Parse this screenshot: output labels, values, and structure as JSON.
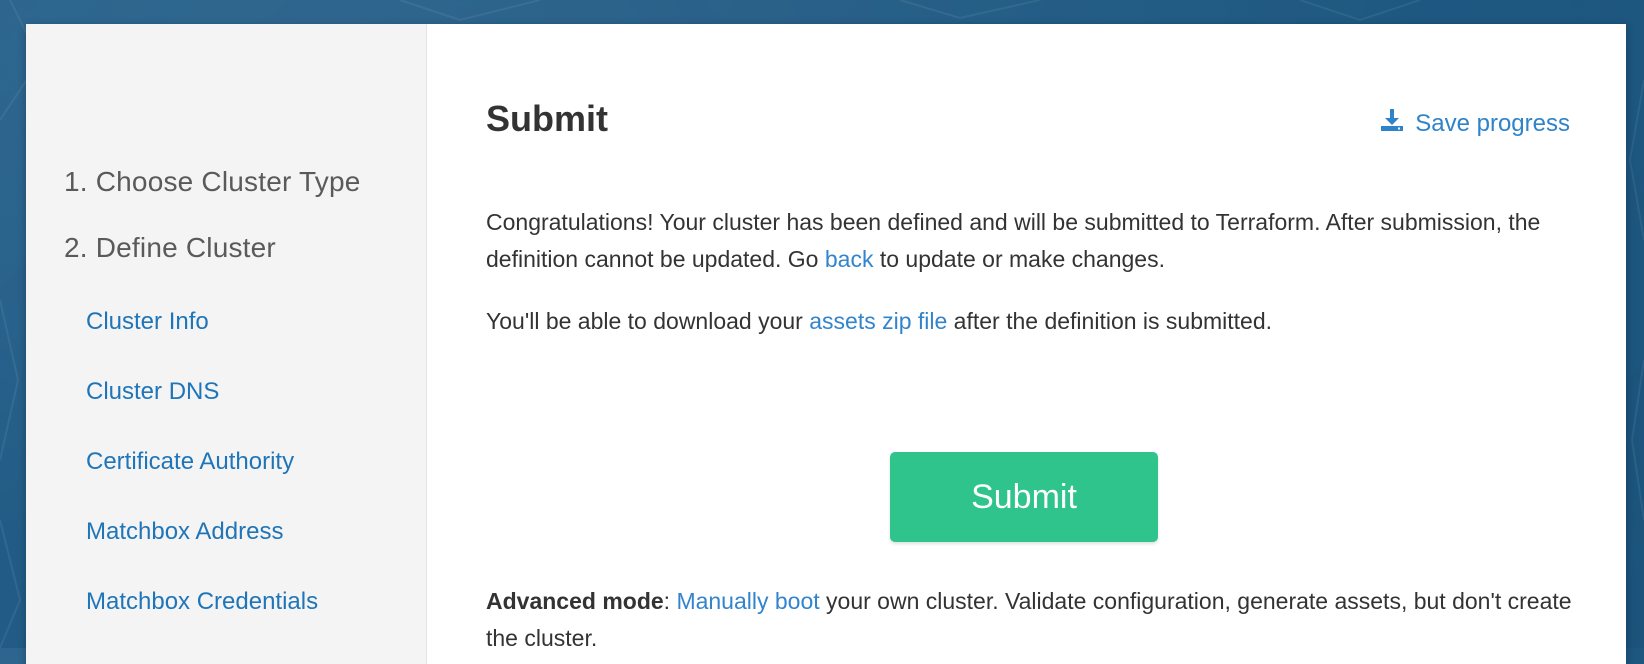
{
  "sidebar": {
    "steps": [
      {
        "label": "1. Choose Cluster Type"
      },
      {
        "label": "2. Define Cluster"
      }
    ],
    "substeps": [
      {
        "label": "Cluster Info"
      },
      {
        "label": "Cluster DNS"
      },
      {
        "label": "Certificate Authority"
      },
      {
        "label": "Matchbox Address"
      },
      {
        "label": "Matchbox Credentials"
      }
    ]
  },
  "main": {
    "title": "Submit",
    "save_progress_label": "Save progress",
    "save_progress_icon": "download-icon",
    "paragraph1": {
      "text_before": "Congratulations! Your cluster has been defined and will be submitted to Terraform. After submission, the definition cannot be updated. Go ",
      "link": "back",
      "text_after": " to update or make changes."
    },
    "paragraph2": {
      "text_before": "You'll be able to download your ",
      "link": "assets zip file",
      "text_after": " after the definition is submitted."
    },
    "submit_button_label": "Submit",
    "advanced": {
      "label": "Advanced mode",
      "colon": ": ",
      "link": "Manually boot",
      "text_after": " your own cluster. Validate configuration, generate assets, but don't create the cluster."
    }
  },
  "colors": {
    "background": "#1d5a86",
    "link": "#3284cc",
    "submit_button": "#2ec48b",
    "sidebar_background": "#f4f4f4"
  }
}
